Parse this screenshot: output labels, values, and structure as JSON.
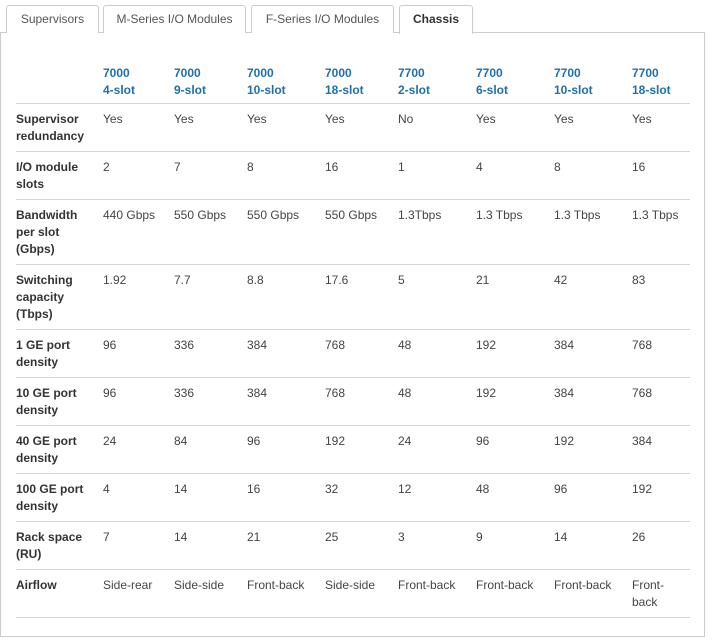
{
  "tabs": [
    {
      "label": "Supervisors",
      "active": false
    },
    {
      "label": "M-Series I/O Modules",
      "active": false
    },
    {
      "label": "F-Series I/O Modules",
      "active": false
    },
    {
      "label": "Chassis",
      "active": true
    }
  ],
  "table": {
    "columns": [
      {
        "line1": "7000",
        "line2": "4-slot"
      },
      {
        "line1": "7000",
        "line2": "9-slot"
      },
      {
        "line1": "7000",
        "line2": "10-slot"
      },
      {
        "line1": "7000",
        "line2": "18-slot"
      },
      {
        "line1": "7700",
        "line2": "2-slot"
      },
      {
        "line1": "7700",
        "line2": "6-slot"
      },
      {
        "line1": "7700",
        "line2": "10-slot"
      },
      {
        "line1": "7700",
        "line2": "18-slot"
      }
    ],
    "rows": [
      {
        "label": "Supervisor redundancy",
        "values": [
          "Yes",
          "Yes",
          "Yes",
          "Yes",
          "No",
          "Yes",
          "Yes",
          "Yes"
        ]
      },
      {
        "label": "I/O module slots",
        "values": [
          "2",
          "7",
          "8",
          "16",
          "1",
          "4",
          "8",
          "16"
        ]
      },
      {
        "label": "Bandwidth per slot (Gbps)",
        "values": [
          "440 Gbps",
          "550 Gbps",
          "550 Gbps",
          "550 Gbps",
          "1.3Tbps",
          "1.3 Tbps",
          "1.3 Tbps",
          "1.3 Tbps"
        ]
      },
      {
        "label": "Switching capacity (Tbps)",
        "values": [
          "1.92",
          "7.7",
          "8.8",
          "17.6",
          "5",
          "21",
          "42",
          "83"
        ]
      },
      {
        "label": "1 GE port density",
        "values": [
          "96",
          "336",
          "384",
          "768",
          "48",
          "192",
          "384",
          "768"
        ]
      },
      {
        "label": "10 GE port density",
        "values": [
          "96",
          "336",
          "384",
          "768",
          "48",
          "192",
          "384",
          "768"
        ]
      },
      {
        "label": "40 GE port density",
        "values": [
          "24",
          "84",
          "96",
          "192",
          "24",
          "96",
          "192",
          "384"
        ]
      },
      {
        "label": "100 GE port density",
        "values": [
          "4",
          "14",
          "16",
          "32",
          "12",
          "48",
          "96",
          "192"
        ]
      },
      {
        "label": "Rack space (RU)",
        "values": [
          "7",
          "14",
          "21",
          "25",
          "3",
          "9",
          "14",
          "26"
        ]
      },
      {
        "label": "Airflow",
        "values": [
          "Side-rear",
          "Side-side",
          "Front-back",
          "Side-side",
          "Front-back",
          "Front-back",
          "Front-back",
          "Front-back"
        ]
      }
    ]
  }
}
